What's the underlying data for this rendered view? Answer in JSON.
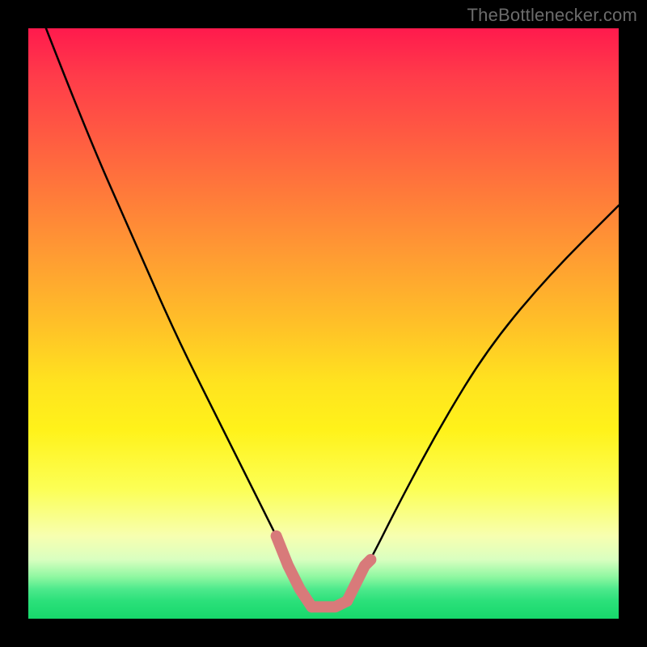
{
  "watermark": "TheBottlenecker.com",
  "chart_data": {
    "type": "line",
    "title": "",
    "xlabel": "",
    "ylabel": "",
    "xlim": [
      0,
      100
    ],
    "ylim": [
      0,
      100
    ],
    "grid": false,
    "series": [
      {
        "name": "bottleneck-curve",
        "x": [
          3,
          10,
          18,
          25,
          32,
          38,
          42,
          45,
          47,
          48,
          50,
          52,
          54,
          55,
          58,
          63,
          70,
          78,
          88,
          100
        ],
        "values": [
          100,
          82,
          64,
          48,
          34,
          22,
          14,
          8,
          4,
          2,
          2,
          2,
          3,
          5,
          10,
          20,
          33,
          46,
          58,
          70
        ]
      }
    ],
    "highlight_segments": [
      {
        "name": "left-knee",
        "x": [
          42,
          44,
          46,
          48
        ],
        "values": [
          14,
          9,
          5,
          2
        ]
      },
      {
        "name": "flat-bottom",
        "x": [
          48,
          50,
          52,
          54
        ],
        "values": [
          2,
          2,
          2,
          3
        ]
      },
      {
        "name": "right-knee",
        "x": [
          54,
          56,
          57,
          58
        ],
        "values": [
          3,
          7,
          9,
          10
        ]
      }
    ],
    "gradient_bands_pct": [
      0,
      8,
      18,
      28,
      38,
      50,
      60,
      68,
      78,
      86,
      90,
      93,
      95,
      97,
      100
    ],
    "gradient_colors": [
      "#ff1a4d",
      "#ff3b4a",
      "#ff5a42",
      "#ff7a3a",
      "#ff9a33",
      "#ffc028",
      "#ffe31f",
      "#fff21a",
      "#fcff55",
      "#f7ffb0",
      "#d9ffc0",
      "#8cf7a0",
      "#4de98c",
      "#2be07a",
      "#17d86b"
    ]
  }
}
